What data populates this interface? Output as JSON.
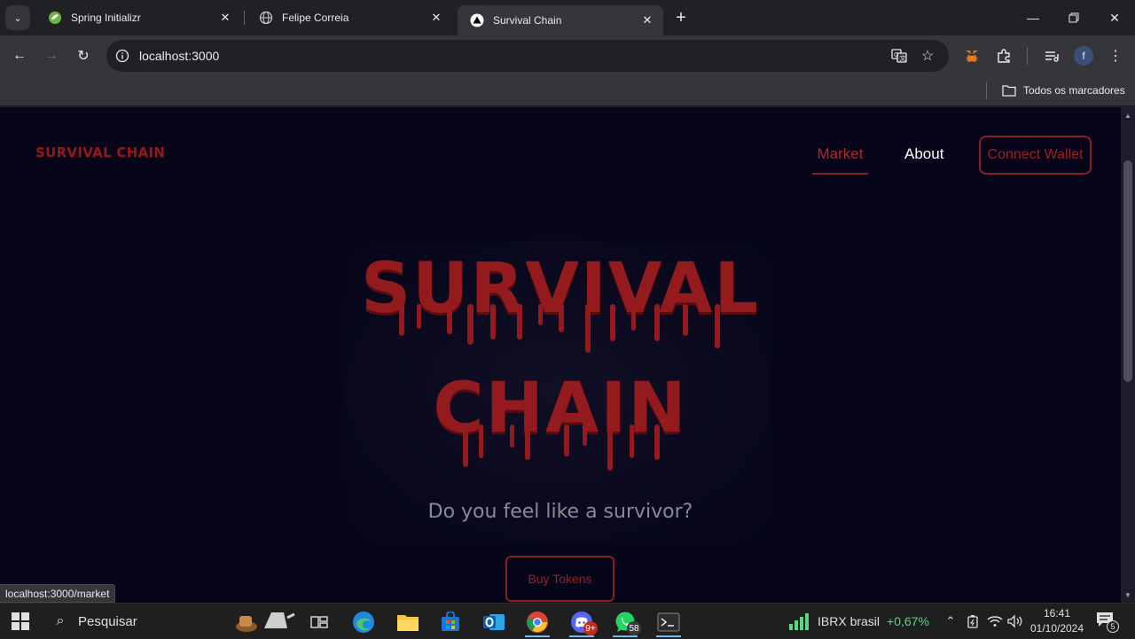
{
  "browser": {
    "tabs": [
      {
        "title": "Spring Initializr",
        "icon": "spring-icon",
        "active": false
      },
      {
        "title": "Felipe Correia",
        "icon": "globe-icon",
        "active": false
      },
      {
        "title": "Survival Chain",
        "icon": "triangle-icon",
        "active": true
      }
    ],
    "url": "localhost:3000",
    "bookmarks_all_label": "Todos os marcadores",
    "status_url": "localhost:3000/market"
  },
  "site": {
    "logo_text": "SURVIVAL CHAIN",
    "nav": {
      "market_label": "Market",
      "about_label": "About"
    },
    "connect_wallet_label": "Connect Wallet",
    "hero": {
      "line1": "SURVIVAL",
      "line2": "CHAIN",
      "subtitle": "Do you feel like a survivor?",
      "cta_label": "Buy Tokens"
    },
    "colors": {
      "background": "#06051a",
      "accent_red": "#931a1d",
      "nav_active": "#b3262a"
    }
  },
  "taskbar": {
    "search_placeholder": "Pesquisar",
    "whatsapp_badge": "58",
    "discord_badge": "9+",
    "ticker_name": "IBRX brasil",
    "ticker_change": "+0,67%",
    "time": "16:41",
    "date": "01/10/2024",
    "notification_count": "5"
  }
}
